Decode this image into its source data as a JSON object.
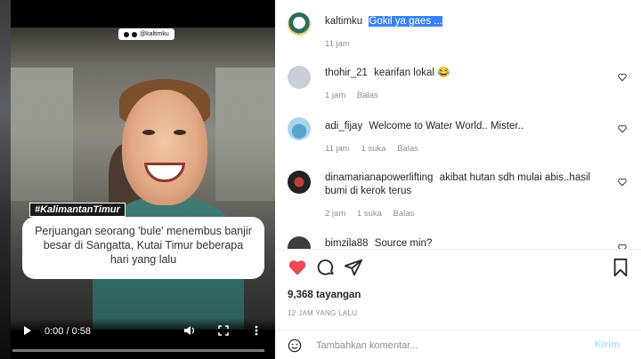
{
  "video": {
    "handle_tag": "@kaltimku",
    "hashtag": "#KalimantanTimur",
    "caption": "Perjuangan seorang 'bule' menembus banjir besar di Sangatta, Kutai Timur beberapa hari yang lalu",
    "time": "0:00 / 0:58",
    "progress": 0
  },
  "post": {
    "author": "kaltimku",
    "caption_selected": "Gokil ya gaes ...",
    "time": "11 jam"
  },
  "comments": [
    {
      "user": "thohir_21",
      "text": "kearifan lokal 😂",
      "time": "1 jam",
      "likes": "",
      "reply": "Balas"
    },
    {
      "user": "adi_fijay",
      "text": "Welcome to Water World.. Mister..",
      "time": "11 jam",
      "likes": "1 suka",
      "reply": "Balas"
    },
    {
      "user": "dinamarianapowerlifting",
      "text": "akibat hutan sdh mulai abis..hasil",
      "text2": "bumi di kerok terus",
      "time": "2 jam",
      "likes": "1 suka",
      "reply": "Balas"
    },
    {
      "user": "bimzila88",
      "text": "Source min?"
    }
  ],
  "stats": {
    "views": "9,368 tayangan",
    "posted": "12 JAM YANG LALU"
  },
  "composer": {
    "placeholder": "Tambahkan komentar...",
    "submit": "Kirim"
  },
  "colors": {
    "like_red": "#ed4956",
    "selection_blue": "#3b82f6",
    "post_disabled": "#b2dffc"
  }
}
